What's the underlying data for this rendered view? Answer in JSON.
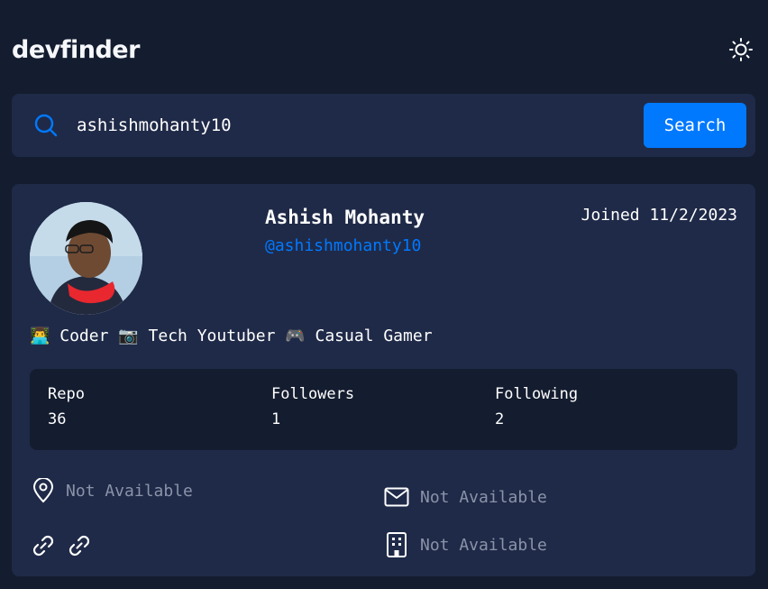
{
  "app": {
    "title": "devfinder"
  },
  "search": {
    "value": "ashishmohanty10",
    "button_label": "Search"
  },
  "profile": {
    "name": "Ashish Mohanty",
    "login": "@ashishmohanty10",
    "joined": "Joined 11/2/2023",
    "bio": "👨‍💻 Coder 📷 Tech Youtuber 🎮 Casual Gamer"
  },
  "stats": [
    {
      "label": "Repo",
      "value": "36"
    },
    {
      "label": "Followers",
      "value": "1"
    },
    {
      "label": "Following",
      "value": "2"
    }
  ],
  "info": {
    "location": "Not Available",
    "email": "Not Available",
    "company": "Not Available"
  },
  "colors": {
    "background": "#141c2f",
    "card": "#1f2a48",
    "accent": "#0079ff",
    "muted_text": "#8a93a8"
  },
  "icons": [
    "sun-icon",
    "search-icon",
    "location-pin-icon",
    "mail-icon",
    "link-icon",
    "building-icon"
  ]
}
